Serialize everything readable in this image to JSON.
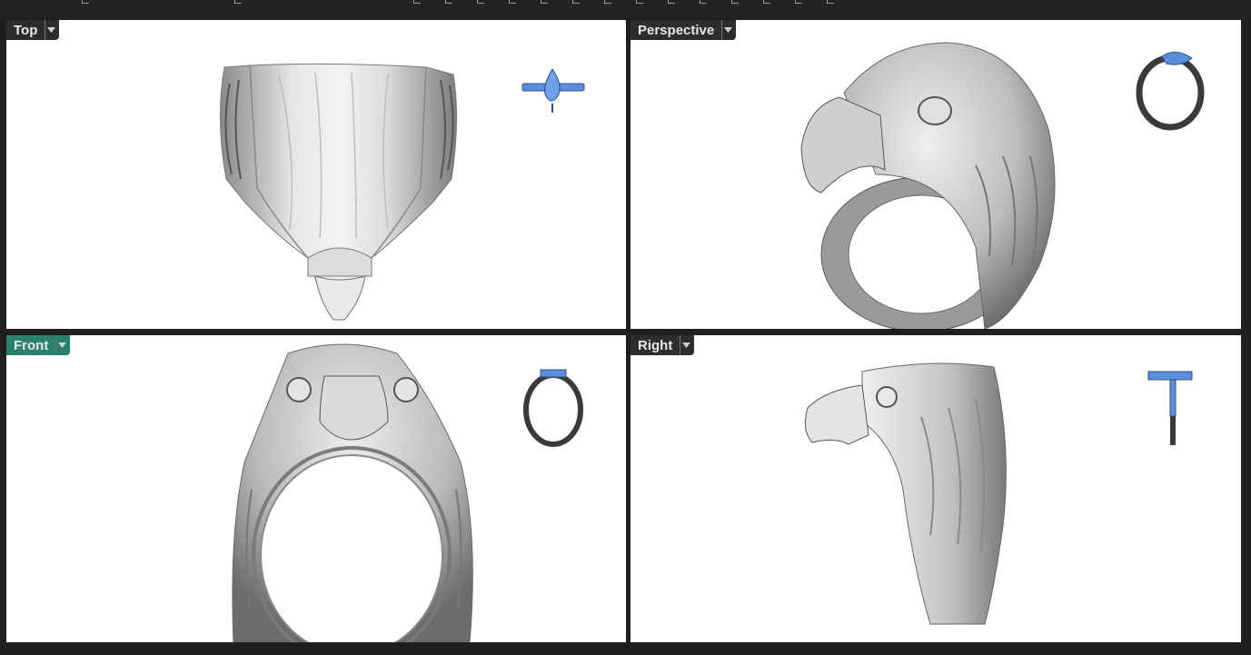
{
  "viewports": {
    "top": {
      "label": "Top"
    },
    "perspective": {
      "label": "Perspective"
    },
    "front": {
      "label": "Front"
    },
    "right": {
      "label": "Right"
    }
  },
  "active_viewport": "Front",
  "icons": {
    "dropdown": "chevron-down-icon"
  },
  "colors": {
    "background": "#1f1f1f",
    "viewport_bg": "#ffffff",
    "tab_bg": "#2d2d2d",
    "tab_active_bg": "#2b7f70",
    "tab_text": "#e8e8e8",
    "gem_blue": "#5b8fdc",
    "metal_gray": "#c9c9c9"
  }
}
